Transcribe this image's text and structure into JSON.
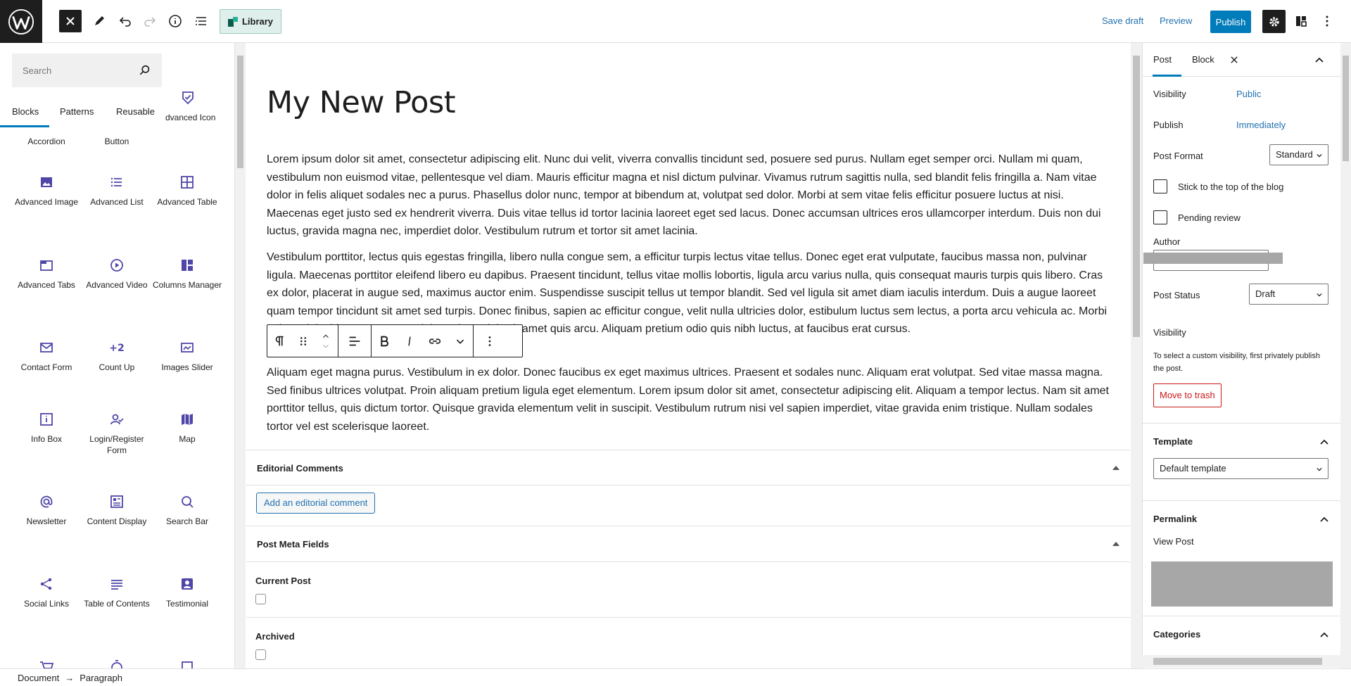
{
  "topbar": {
    "library_label": "Library",
    "save_draft_label": "Save draft",
    "preview_label": "Preview",
    "publish_label": "Publish"
  },
  "inserter": {
    "search_placeholder": "Search",
    "tabs": [
      "Blocks",
      "Patterns",
      "Reusable"
    ],
    "partial_items": [
      "Accordion",
      "Button",
      "dvanced Icon"
    ],
    "blocks": [
      {
        "label": "Advanced Image",
        "icon": "image-icon"
      },
      {
        "label": "Advanced List",
        "icon": "list-icon"
      },
      {
        "label": "Advanced Table",
        "icon": "table-icon"
      },
      {
        "label": "Advanced Tabs",
        "icon": "tabs-icon"
      },
      {
        "label": "Advanced Video",
        "icon": "video-icon"
      },
      {
        "label": "Columns Manager",
        "icon": "columns-icon"
      },
      {
        "label": "Contact Form",
        "icon": "mail-icon"
      },
      {
        "label": "Count Up",
        "icon": "count-up-icon",
        "glyph": "+2"
      },
      {
        "label": "Images Slider",
        "icon": "slider-icon"
      },
      {
        "label": "Info Box",
        "icon": "info-box-icon"
      },
      {
        "label": "Login/Register Form",
        "icon": "login-icon"
      },
      {
        "label": "Map",
        "icon": "map-icon"
      },
      {
        "label": "Newsletter",
        "icon": "at-icon"
      },
      {
        "label": "Content Display",
        "icon": "content-display-icon"
      },
      {
        "label": "Search Bar",
        "icon": "search-icon"
      },
      {
        "label": "Social Links",
        "icon": "share-icon"
      },
      {
        "label": "Table of Contents",
        "icon": "toc-icon"
      },
      {
        "label": "Testimonial",
        "icon": "testimonial-icon"
      }
    ],
    "accent_color": "#4f46a8"
  },
  "editor": {
    "title": "My New Post",
    "paragraphs": [
      "Lorem ipsum dolor sit amet, consectetur adipiscing elit. Nunc dui velit, viverra convallis tincidunt sed, posuere sed purus. Nullam eget semper orci. Nullam mi quam, vestibulum non euismod vitae, pellentesque vel diam. Mauris efficitur magna et nisl dictum pulvinar. Vivamus rutrum sagittis nulla, sed blandit felis fringilla a. Nam vitae dolor in felis aliquet sodales nec a purus. Phasellus dolor nunc, tempor at bibendum at, volutpat sed dolor. Morbi at sem vitae felis efficitur posuere luctus at nisi. Maecenas eget justo sed ex hendrerit viverra. Duis vitae tellus id tortor lacinia laoreet eget sed lacus. Donec accumsan ultrices eros ullamcorper interdum. Duis non dui luctus, gravida magna nec, imperdiet dolor. Vestibulum rutrum et tortor sit amet lacinia.",
      "Vestibulum porttitor, lectus quis egestas fringilla, libero nulla congue sem, a efficitur turpis lectus vitae tellus. Donec eget erat vulputate, faucibus massa non, pulvinar ligula. Maecenas porttitor eleifend libero eu dapibus. Praesent tincidunt, tellus vitae mollis lobortis, ligula arcu varius nulla, quis consequat mauris turpis quis libero. Cras ex dolor, placerat in augue sed, maximus auctor enim. Suspendisse suscipit tellus ut tempor blandit. Sed vel ligula sit amet diam iaculis interdum. Duis a augue laoreet quam tempor tincidunt sit amet sed turpis. Donec finibus, sapien ac efficitur congue, velit nulla ultricies dolor, estibulum luctus sem lectus, a porta arcu vehicula ac. Morbi euismod tincidunt ante, et suscipit turpis sagittis sit amet quis arcu. Aliquam pretium odio quis nibh luctus, at faucibus erat cursus.",
      "Aliquam eget magna purus. Vestibulum in ex dolor. Donec faucibus ex eget maximus ultrices. Praesent et sodales nunc. Aliquam erat volutpat. Sed vitae massa magna. Sed finibus ultrices volutpat. Proin aliquam pretium ligula eget elementum. Lorem ipsum dolor sit amet, consectetur adipiscing elit. Aliquam a tempor lectus. Nam sit amet porttitor tellus, quis dictum tortor. Quisque gravida elementum velit in suscipit. Vestibulum rutrum nisi vel sapien imperdiet, vitae gravida enim tristique. Nullam sodales tortor vel est scelerisque laoreet."
    ],
    "editorial_comments": {
      "heading": "Editorial Comments",
      "button_label": "Add an editorial comment"
    },
    "post_meta": {
      "heading": "Post Meta Fields",
      "fields": [
        "Current Post",
        "Archived"
      ]
    }
  },
  "sidebar": {
    "tabs": [
      "Post",
      "Block"
    ],
    "visibility_label": "Visibility",
    "visibility_value": "Public",
    "publish_label": "Publish",
    "publish_value": "Immediately",
    "post_format_label": "Post Format",
    "post_format_value": "Standard",
    "sticky_label": "Stick to the top of the blog",
    "pending_label": "Pending review",
    "author_label": "Author",
    "post_status_label": "Post Status",
    "post_status_value": "Draft",
    "visibility2_label": "Visibility",
    "visibility_note": "To select a custom visibility, first privately publish the post.",
    "trash_label": "Move to trash",
    "template_heading": "Template",
    "template_value": "Default template",
    "permalink_heading": "Permalink",
    "view_post_label": "View Post",
    "categories_heading": "Categories"
  },
  "footer": {
    "breadcrumb": [
      "Document",
      "Paragraph"
    ],
    "separator": "→"
  }
}
